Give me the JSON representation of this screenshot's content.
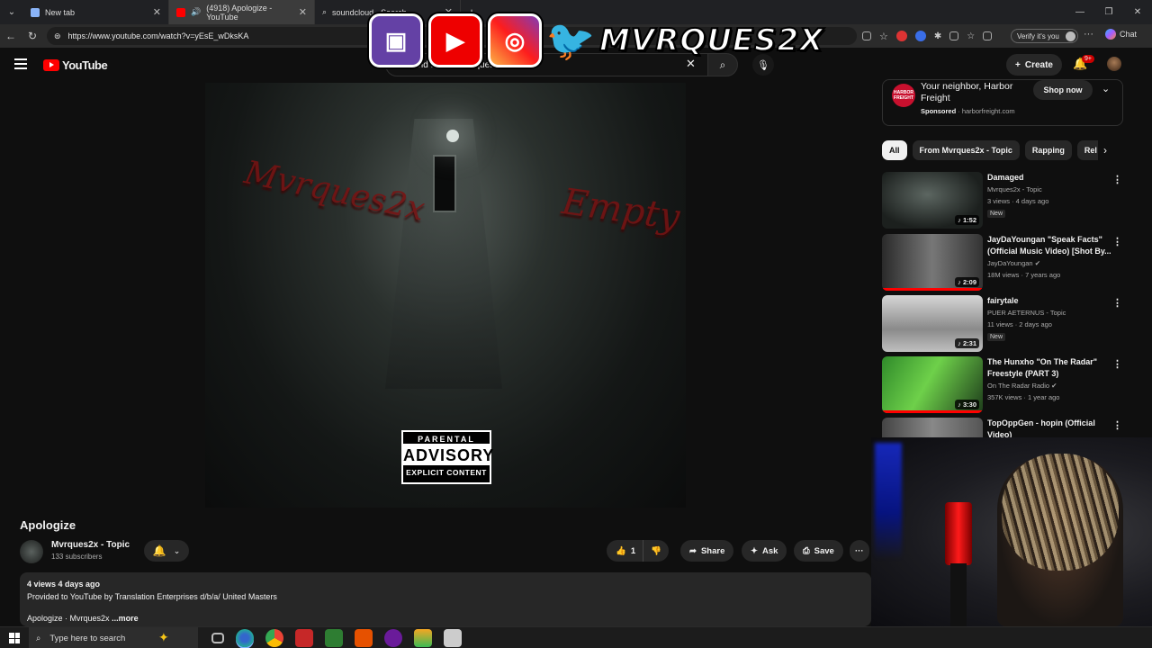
{
  "browser": {
    "tabs": [
      {
        "title": "New tab",
        "active": false
      },
      {
        "title": "(4918) Apologize - YouTube",
        "active": true
      },
      {
        "title": "soundcloud - Search",
        "active": false
      }
    ],
    "url": "https://www.youtube.com/watch?v=yEsE_wDksKA",
    "verify_label": "Verify it's you",
    "chat_label": "Chat"
  },
  "overlay": {
    "handle": "MVRQUES2X"
  },
  "youtube": {
    "logo_text": "YouTube",
    "search_value": "...s and stones mvrques2x",
    "create_label": "Create",
    "notif_badge": "9+"
  },
  "video": {
    "graffiti_left": "Mvrques2x",
    "graffiti_right": "Empty",
    "advisory": {
      "line1": "PARENTAL",
      "line2": "ADVISORY",
      "line3": "EXPLICIT CONTENT"
    },
    "title": "Apologize",
    "channel": "Mvrques2x - Topic",
    "subscribers": "133 subscribers",
    "likes": "1",
    "share_label": "Share",
    "ask_label": "Ask",
    "save_label": "Save",
    "description": {
      "meta": "4 views  4 days ago",
      "provided": "Provided to YouTube by Translation Enterprises d/b/a/ United Masters",
      "line3": "Apologize · Mvrques2x",
      "more": "...more"
    }
  },
  "ad": {
    "brand_logo": "HARBOR FREIGHT",
    "title": "Your neighbor, Harbor Freight",
    "sponsored": "Sponsored",
    "domain": "harborfreight.com",
    "cta": "Shop now"
  },
  "chips": [
    "All",
    "From Mvrques2x - Topic",
    "Rapping",
    "Rel"
  ],
  "recommendations": [
    {
      "title": "Damaged",
      "channel": "Mvrques2x - Topic",
      "stats": "3 views · 4 days ago",
      "badge": "New",
      "duration": "1:52",
      "progress": 0
    },
    {
      "title": "JayDaYoungan \"Speak Facts\" (Official Music Video) [Shot By...",
      "channel": "JayDaYoungan",
      "stats": "18M views · 7 years ago",
      "badge": "",
      "duration": "2:09",
      "progress": 1.0
    },
    {
      "title": "fairytale",
      "channel": "PUER AETERNUS - Topic",
      "stats": "11 views · 2 days ago",
      "badge": "New",
      "duration": "2:31",
      "progress": 0
    },
    {
      "title": "The Hunxho \"On The Radar\" Freestyle (PART 3)",
      "channel": "On The Radar Radio",
      "stats": "357K views · 1 year ago",
      "badge": "",
      "duration": "3:30",
      "progress": 1.0
    },
    {
      "title": "TopOppGen - hopin (Official Video)",
      "channel": "",
      "stats": "",
      "badge": "",
      "duration": "",
      "progress": 0
    }
  ],
  "taskbar": {
    "search_placeholder": "Type here to search"
  },
  "colors": {
    "yt_red": "#ff0000",
    "bg": "#0f0f0f",
    "pill": "#272727"
  }
}
